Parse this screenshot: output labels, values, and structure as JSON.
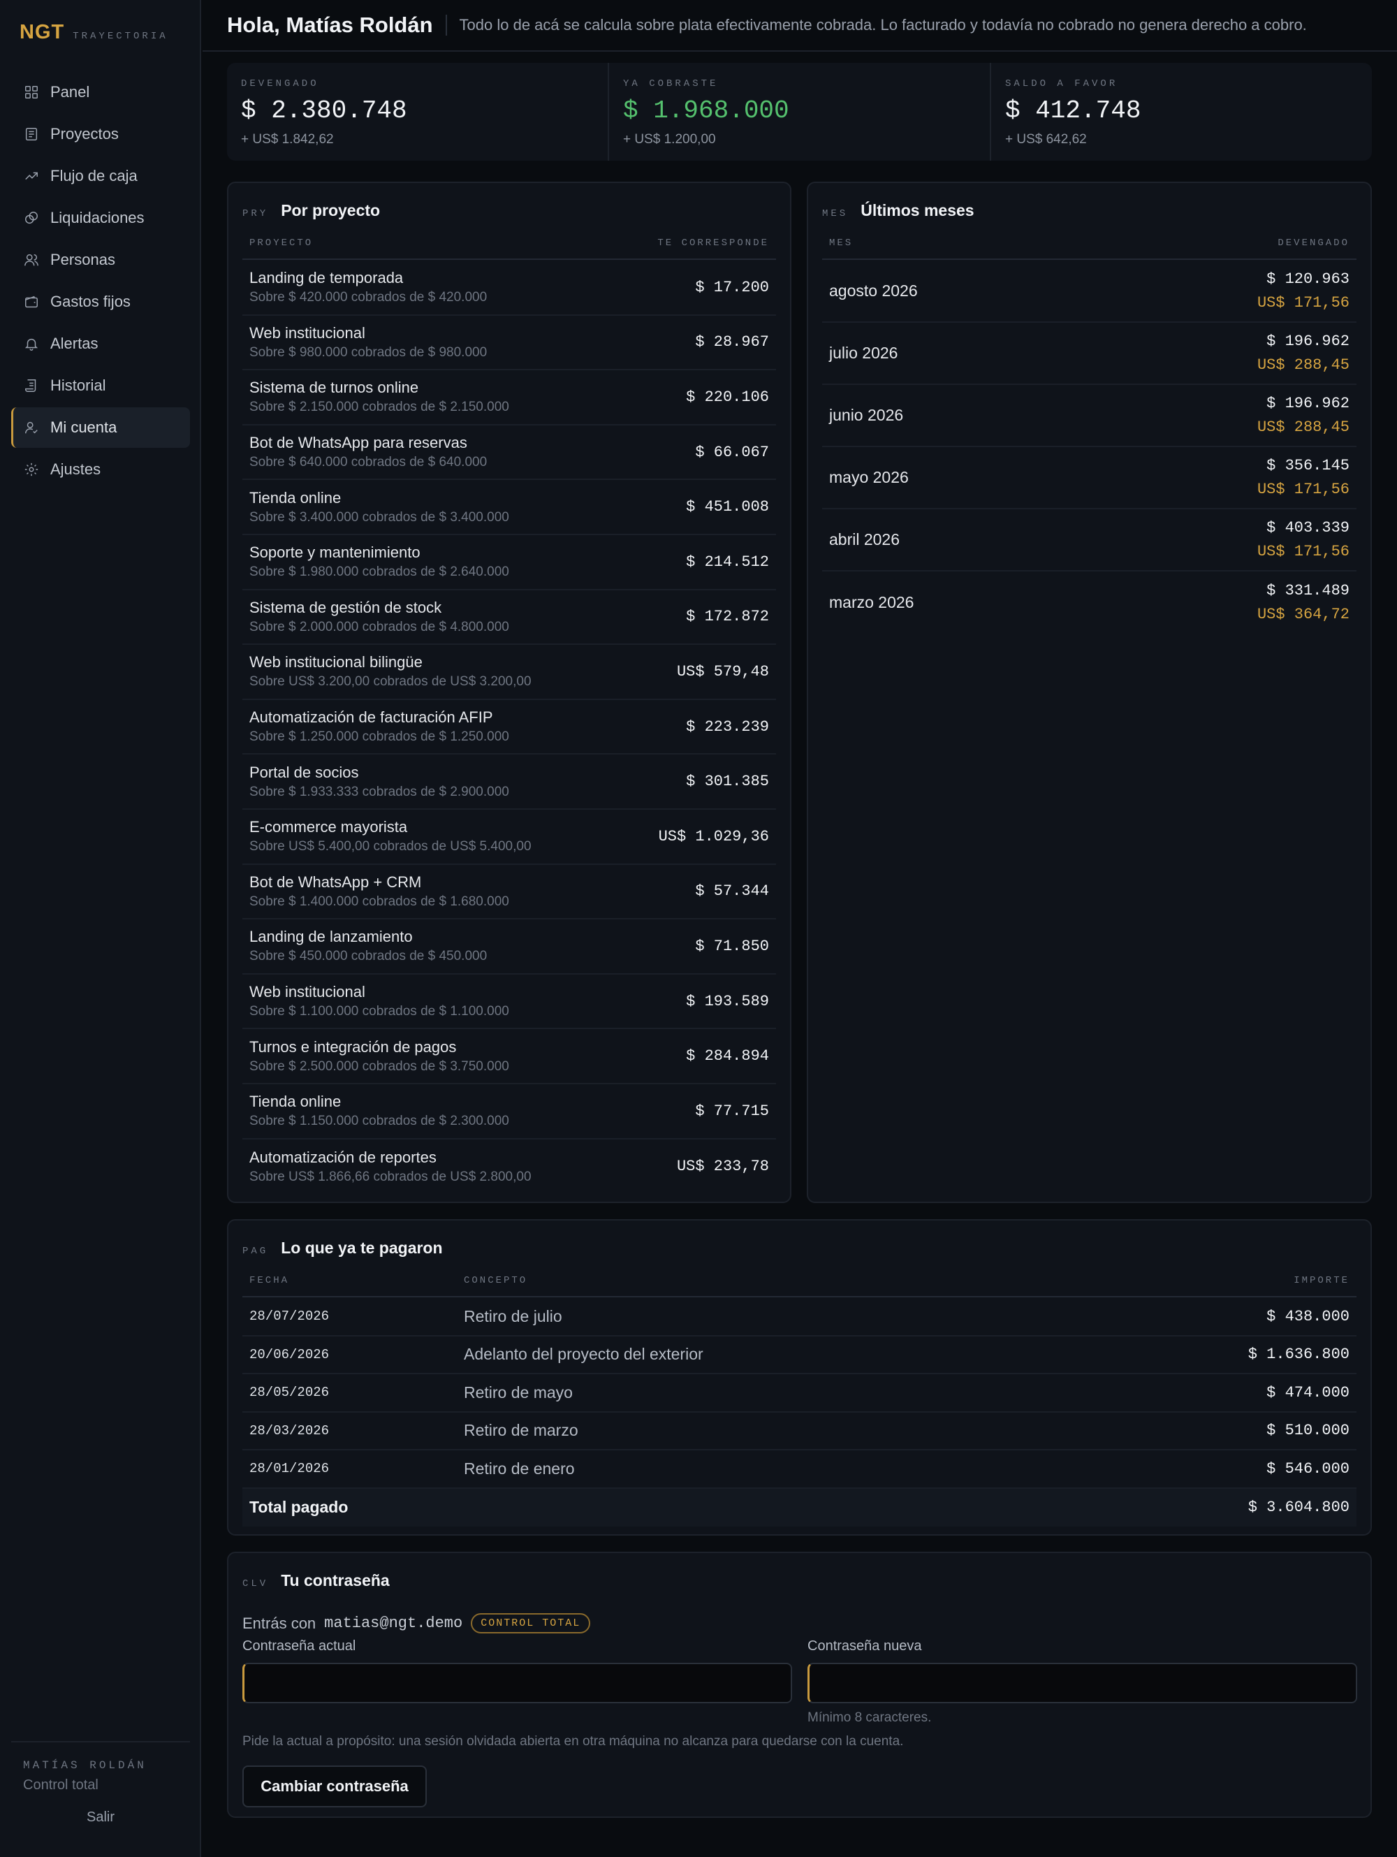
{
  "brand": {
    "logo": "NGT",
    "subtitle": "TRAYECTORIA"
  },
  "nav": {
    "items": [
      {
        "label": "Panel",
        "icon": "grid-icon"
      },
      {
        "label": "Proyectos",
        "icon": "document-icon"
      },
      {
        "label": "Flujo de caja",
        "icon": "trend-icon"
      },
      {
        "label": "Liquidaciones",
        "icon": "coins-icon"
      },
      {
        "label": "Personas",
        "icon": "users-icon"
      },
      {
        "label": "Gastos fijos",
        "icon": "wallet-icon"
      },
      {
        "label": "Alertas",
        "icon": "bell-icon"
      },
      {
        "label": "Historial",
        "icon": "scroll-icon"
      },
      {
        "label": "Mi cuenta",
        "icon": "user-icon",
        "active": true
      },
      {
        "label": "Ajustes",
        "icon": "gear-icon"
      }
    ]
  },
  "sidebar_user": {
    "name": "MATÍAS ROLDÁN",
    "role": "Control total",
    "logout": "Salir"
  },
  "header": {
    "title": "Hola, Matías Roldán",
    "subtitle": "Todo lo de acá se calcula sobre plata efectivamente cobrada. Lo facturado y todavía no cobrado no genera derecho a cobro."
  },
  "stats": [
    {
      "label": "DEVENGADO",
      "value": "$ 2.380.748",
      "sub": "+ US$ 1.842,62"
    },
    {
      "label": "YA COBRASTE",
      "value": "$ 1.968.000",
      "sub": "+ US$ 1.200,00"
    },
    {
      "label": "SALDO A FAVOR",
      "value": "$ 412.748",
      "sub": "+ US$ 642,62"
    }
  ],
  "projects": {
    "code": "PRY",
    "title": "Por proyecto",
    "col_project": "PROYECTO",
    "col_amount": "TE CORRESPONDE",
    "rows": [
      {
        "name": "Landing de temporada",
        "note": "Sobre $ 420.000 cobrados de $ 420.000",
        "amount": "$ 17.200"
      },
      {
        "name": "Web institucional",
        "note": "Sobre $ 980.000 cobrados de $ 980.000",
        "amount": "$ 28.967"
      },
      {
        "name": "Sistema de turnos online",
        "note": "Sobre $ 2.150.000 cobrados de $ 2.150.000",
        "amount": "$ 220.106"
      },
      {
        "name": "Bot de WhatsApp para reservas",
        "note": "Sobre $ 640.000 cobrados de $ 640.000",
        "amount": "$ 66.067"
      },
      {
        "name": "Tienda online",
        "note": "Sobre $ 3.400.000 cobrados de $ 3.400.000",
        "amount": "$ 451.008"
      },
      {
        "name": "Soporte y mantenimiento",
        "note": "Sobre $ 1.980.000 cobrados de $ 2.640.000",
        "amount": "$ 214.512"
      },
      {
        "name": "Sistema de gestión de stock",
        "note": "Sobre $ 2.000.000 cobrados de $ 4.800.000",
        "amount": "$ 172.872"
      },
      {
        "name": "Web institucional bilingüe",
        "note": "Sobre US$ 3.200,00 cobrados de US$ 3.200,00",
        "amount": "US$ 579,48"
      },
      {
        "name": "Automatización de facturación AFIP",
        "note": "Sobre $ 1.250.000 cobrados de $ 1.250.000",
        "amount": "$ 223.239"
      },
      {
        "name": "Portal de socios",
        "note": "Sobre $ 1.933.333 cobrados de $ 2.900.000",
        "amount": "$ 301.385"
      },
      {
        "name": "E-commerce mayorista",
        "note": "Sobre US$ 5.400,00 cobrados de US$ 5.400,00",
        "amount": "US$ 1.029,36"
      },
      {
        "name": "Bot de WhatsApp + CRM",
        "note": "Sobre $ 1.400.000 cobrados de $ 1.680.000",
        "amount": "$ 57.344"
      },
      {
        "name": "Landing de lanzamiento",
        "note": "Sobre $ 450.000 cobrados de $ 450.000",
        "amount": "$ 71.850"
      },
      {
        "name": "Web institucional",
        "note": "Sobre $ 1.100.000 cobrados de $ 1.100.000",
        "amount": "$ 193.589"
      },
      {
        "name": "Turnos e integración de pagos",
        "note": "Sobre $ 2.500.000 cobrados de $ 3.750.000",
        "amount": "$ 284.894"
      },
      {
        "name": "Tienda online",
        "note": "Sobre $ 1.150.000 cobrados de $ 2.300.000",
        "amount": "$ 77.715"
      },
      {
        "name": "Automatización de reportes",
        "note": "Sobre US$ 1.866,66 cobrados de US$ 2.800,00",
        "amount": "US$ 233,78"
      }
    ]
  },
  "months": {
    "code": "MES",
    "title": "Últimos meses",
    "col_month": "MES",
    "col_amount": "DEVENGADO",
    "rows": [
      {
        "month": "agosto 2026",
        "ars": "$ 120.963",
        "usd": "US$ 171,56"
      },
      {
        "month": "julio 2026",
        "ars": "$ 196.962",
        "usd": "US$ 288,45"
      },
      {
        "month": "junio 2026",
        "ars": "$ 196.962",
        "usd": "US$ 288,45"
      },
      {
        "month": "mayo 2026",
        "ars": "$ 356.145",
        "usd": "US$ 171,56"
      },
      {
        "month": "abril 2026",
        "ars": "$ 403.339",
        "usd": "US$ 171,56"
      },
      {
        "month": "marzo 2026",
        "ars": "$ 331.489",
        "usd": "US$ 364,72"
      }
    ]
  },
  "payments": {
    "code": "PAG",
    "title": "Lo que ya te pagaron",
    "col_date": "FECHA",
    "col_concept": "CONCEPTO",
    "col_amount": "IMPORTE",
    "rows": [
      {
        "date": "28/07/2026",
        "concept": "Retiro de julio",
        "amount": "$ 438.000"
      },
      {
        "date": "20/06/2026",
        "concept": "Adelanto del proyecto del exterior",
        "amount": "$ 1.636.800"
      },
      {
        "date": "28/05/2026",
        "concept": "Retiro de mayo",
        "amount": "$ 474.000"
      },
      {
        "date": "28/03/2026",
        "concept": "Retiro de marzo",
        "amount": "$ 510.000"
      },
      {
        "date": "28/01/2026",
        "concept": "Retiro de enero",
        "amount": "$ 546.000"
      }
    ],
    "total_label": "Total pagado",
    "total_amount": "$ 3.604.800"
  },
  "password": {
    "code": "CLV",
    "title": "Tu contraseña",
    "login_prefix": "Entrás con",
    "email": "matias@ngt.demo",
    "badge": "CONTROL TOTAL",
    "current_label": "Contraseña actual",
    "current_value": "",
    "new_label": "Contraseña nueva",
    "new_value": "",
    "new_hint": "Mínimo 8 caracteres.",
    "note": "Pide la actual a propósito: una sesión olvidada abierta en otra máquina no alcanza para quedarse con la cuenta.",
    "button": "Cambiar contraseña"
  },
  "colors": {
    "accent": "#d6a441",
    "positive": "#55c16e",
    "background": "#090c10",
    "panel": "#0f131a"
  }
}
